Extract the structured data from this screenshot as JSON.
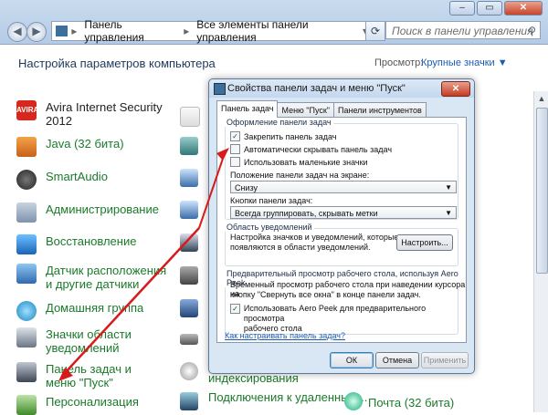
{
  "window": {
    "min_label": "–",
    "max_label": "▭",
    "close_label": "✕"
  },
  "nav": {
    "back_label": "◀",
    "forward_label": "▶"
  },
  "address": {
    "root": "▸",
    "sep": "▸",
    "crumb1": "Панель управления",
    "crumb2": "Все элементы панели управления",
    "dropdown": "▾"
  },
  "search": {
    "placeholder": "Поиск в панели управления",
    "icon": "⚲"
  },
  "page": {
    "heading": "Настройка параметров компьютера",
    "view_label": "Просмотр:",
    "view_value": "Крупные значки ▼"
  },
  "items": [
    {
      "label": "Avira Internet Security 2012",
      "color": "#d8281e"
    },
    {
      "label": "Java (32 бита)",
      "color": "#e67b18"
    },
    {
      "label": "SmartAudio",
      "color": "#333"
    },
    {
      "label": "Администрирование",
      "color": "#6e8aa8"
    },
    {
      "label": "Восстановление",
      "color": "#2d7fd1"
    },
    {
      "label": "Датчик расположения и другие датчики",
      "color": "#3a76c0"
    },
    {
      "label": "Домашняя группа",
      "color": "#2aa0d8"
    },
    {
      "label": "Значки области уведомлений",
      "color": "#6a7486"
    },
    {
      "label": "Панель задач и меню \"Пуск\"",
      "color": "#555"
    },
    {
      "label": "Персонализация",
      "color": "#4a8a3a"
    }
  ],
  "right_items": [
    {
      "label": "индексирования"
    },
    {
      "label": "Подключения к удаленным..."
    },
    {
      "label": "Почта (32 бита)"
    }
  ],
  "dialog": {
    "title": "Свойства панели задач и меню \"Пуск\"",
    "close": "✕",
    "tabs": [
      "Панель задач",
      "Меню \"Пуск\"",
      "Панели инструментов"
    ],
    "group1_title": "Оформление панели задач",
    "cb1": "Закрепить панель задач",
    "cb2": "Автоматически скрывать панель задач",
    "cb3": "Использовать маленькие значки",
    "pos_label": "Положение панели задач на экране:",
    "pos_value": "Снизу",
    "btns_label": "Кнопки панели задач:",
    "btns_value": "Всегда группировать, скрывать метки",
    "group2_title": "Область уведомлений",
    "notify_text1": "Настройка значков и уведомлений, которые",
    "notify_text2": "появляются в области уведомлений.",
    "customize": "Настроить...",
    "group3_title": "Предварительный просмотр рабочего стола, используя Aero Peek",
    "peek_text1": "Временный просмотр рабочего стола при наведении курсора на",
    "peek_text2": "кнопку \"Свернуть все окна\" в конце панели задач.",
    "cb4a": "Использовать Aero Peek для предварительного просмотра",
    "cb4b": "рабочего стола",
    "link": "Как настраивать панель задач?",
    "ok": "ОК",
    "cancel": "Отмена",
    "apply": "Применить"
  },
  "annotation_color": "#d81a1a"
}
